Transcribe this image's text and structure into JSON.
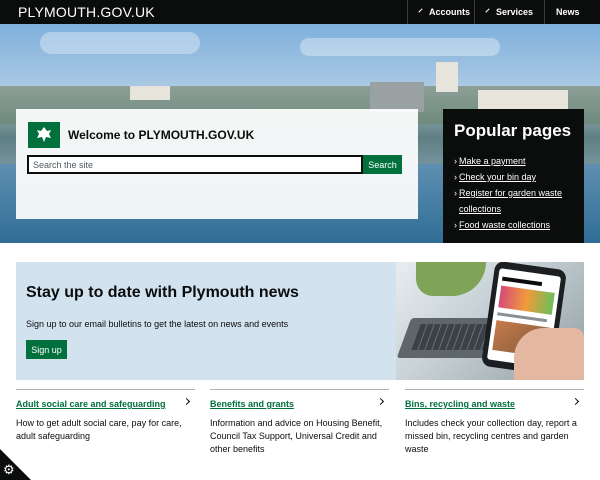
{
  "header": {
    "brand": "PLYMOUTH.GOV.UK",
    "nav": [
      {
        "label": "Accounts",
        "icon": "chevron-down-icon"
      },
      {
        "label": "Services",
        "icon": "chevron-down-icon"
      },
      {
        "label": "News"
      }
    ]
  },
  "hero": {
    "welcome": "Welcome to PLYMOUTH.GOV.UK",
    "search_placeholder": "Search the site",
    "search_button": "Search",
    "logo_icon": "plymouth-crest-icon"
  },
  "popular": {
    "title": "Popular pages",
    "links": [
      "Make a payment",
      "Check your bin day",
      "Register for garden waste collections",
      "Food waste collections"
    ]
  },
  "newsletter": {
    "title": "Stay up to date with Plymouth news",
    "text": "Sign up to our email bulletins to get the latest on news and events",
    "button": "Sign up"
  },
  "services": [
    {
      "title": "Adult social care and safeguarding",
      "desc": "How to get adult social care, pay for care, adult safeguarding"
    },
    {
      "title": "Benefits and grants",
      "desc": "Information and advice on Housing Benefit, Council Tax Support, Universal Credit and other benefits"
    },
    {
      "title": "Bins, recycling and waste",
      "desc": "Includes check your collection day, report a missed bin, recycling centres and garden waste"
    }
  ],
  "colors": {
    "brand_green": "#00703c",
    "header_black": "#0b0c0c",
    "banner_blue": "#d2e2ef"
  }
}
